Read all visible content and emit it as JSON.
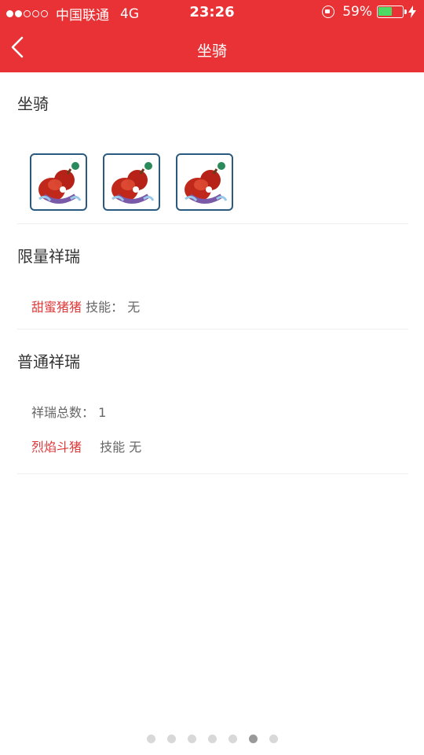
{
  "status_bar": {
    "signal_bars": 2,
    "signal_total": 5,
    "carrier": "中国联通",
    "network": "4G",
    "time": "23:26",
    "battery_percent": "59%",
    "battery_level": 0.59,
    "icons": [
      "orientation-lock-icon",
      "battery-icon",
      "charging-bolt-icon"
    ]
  },
  "nav": {
    "back_icon": "chevron-left-icon",
    "title": "坐骑"
  },
  "mount_section": {
    "title": "坐骑",
    "mount_count_shown": 3
  },
  "limited_section": {
    "title": "限量祥瑞",
    "item_name": "甜蜜猪猪",
    "skill_text": "技能： 无"
  },
  "normal_section": {
    "title": "普通祥瑞",
    "total_label": "祥瑞总数：",
    "total_value": "1",
    "item_name": "烈焰斗猪",
    "skill_text": "技能 无"
  },
  "pager": {
    "total": 7,
    "active_index": 5
  },
  "colors": {
    "accent": "#e83236",
    "item_red": "#e03a3a",
    "battery_green": "#4cd964"
  }
}
